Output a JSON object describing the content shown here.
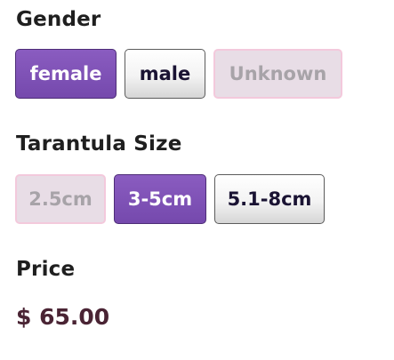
{
  "gender": {
    "label": "Gender",
    "options": [
      {
        "label": "female",
        "state": "selected"
      },
      {
        "label": "male",
        "state": "available"
      },
      {
        "label": "Unknown",
        "state": "disabled"
      }
    ]
  },
  "size": {
    "label": "Tarantula Size",
    "options": [
      {
        "label": "2.5cm",
        "state": "disabled"
      },
      {
        "label": "3-5cm",
        "state": "selected"
      },
      {
        "label": "5.1-8cm",
        "state": "available"
      }
    ]
  },
  "price": {
    "label": "Price",
    "value": "$ 65.00"
  },
  "colors": {
    "selected": "#7f52b6",
    "disabled_bg": "#e8dde6",
    "disabled_border": "#f3c9dc",
    "price_text": "#4a2434"
  }
}
